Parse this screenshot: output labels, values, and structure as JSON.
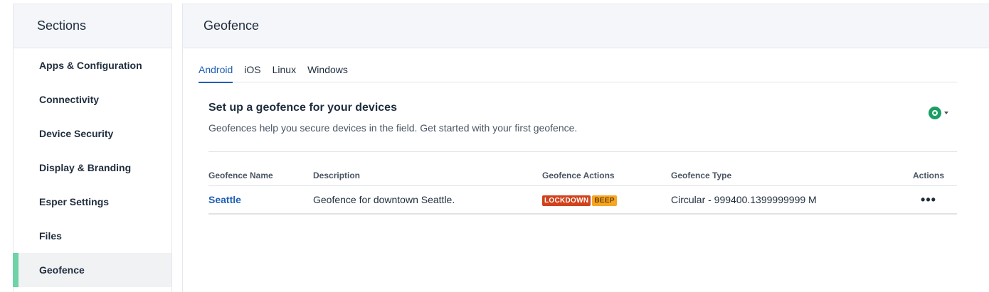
{
  "sidebar": {
    "title": "Sections",
    "items": [
      {
        "label": "Apps & Configuration"
      },
      {
        "label": "Connectivity"
      },
      {
        "label": "Device Security"
      },
      {
        "label": "Display & Branding"
      },
      {
        "label": "Esper Settings"
      },
      {
        "label": "Files"
      },
      {
        "label": "Geofence"
      }
    ],
    "active_index": 6
  },
  "main": {
    "title": "Geofence",
    "tabs": [
      {
        "label": "Android"
      },
      {
        "label": "iOS"
      },
      {
        "label": "Linux"
      },
      {
        "label": "Windows"
      }
    ],
    "active_tab": "Android",
    "card": {
      "title": "Set up a geofence for your devices",
      "subtitle": "Geofences help you secure devices in the field. Get started with your first geofence.",
      "action_icon": "add-circle-icon"
    },
    "table": {
      "headers": [
        "Geofence Name",
        "Description",
        "Geofence Actions",
        "Geofence Type",
        "Actions"
      ],
      "rows": [
        {
          "name": "Seattle",
          "description": "Geofence for downtown Seattle.",
          "actions": [
            "LOCKDOWN",
            "BEEP"
          ],
          "type": "Circular - 999400.1399999999 M",
          "menu": "•••"
        }
      ]
    }
  },
  "colors": {
    "accent": "#1e5fb4",
    "active_marker": "#6fd3a8",
    "lockdown_badge": "#d0421b",
    "beep_badge": "#f5a623",
    "icon_green": "#1b9e66"
  }
}
